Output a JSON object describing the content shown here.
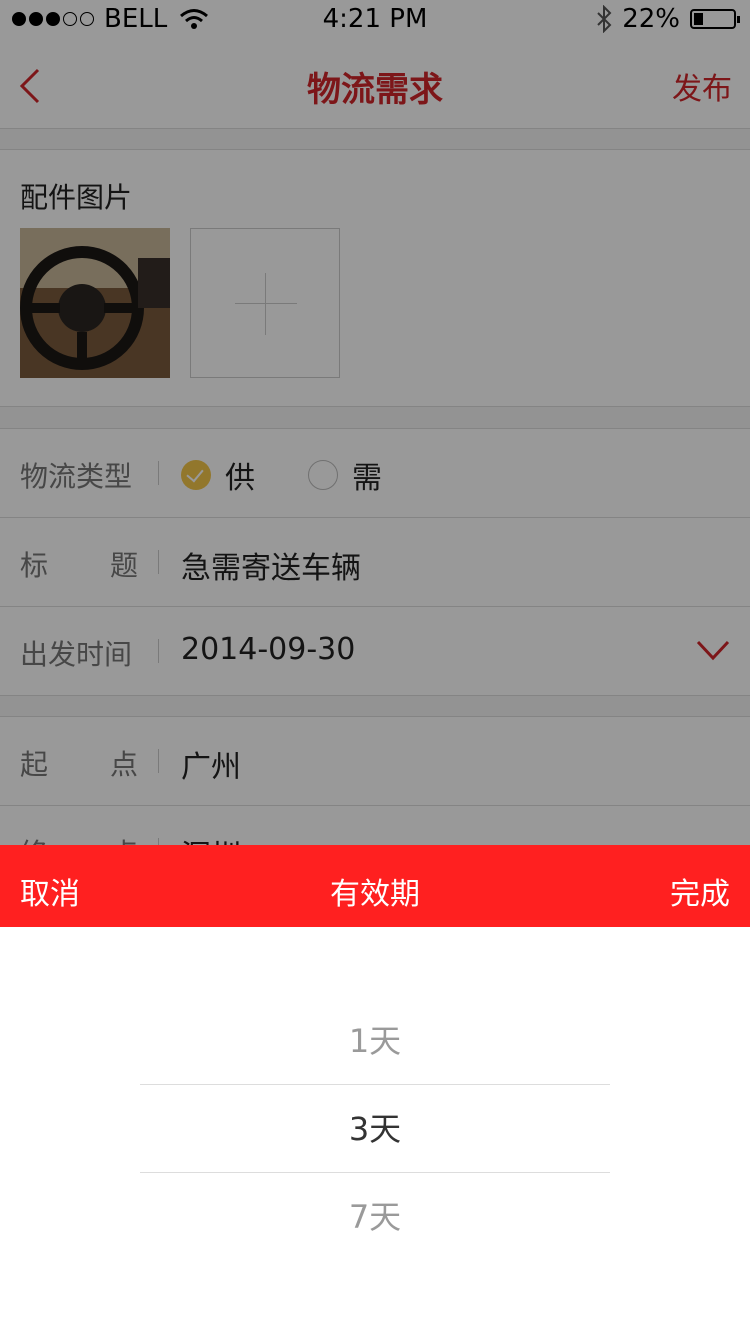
{
  "status_bar": {
    "carrier": "BELL",
    "time": "4:21 PM",
    "battery": "22%",
    "battery_level_percent": 22
  },
  "nav": {
    "title": "物流需求",
    "publish": "发布"
  },
  "photos": {
    "label": "配件图片"
  },
  "type_row": {
    "label": "物流类型",
    "options": [
      "供",
      "需"
    ],
    "selected": "供"
  },
  "title_row": {
    "label_a": "标",
    "label_b": "题",
    "value": "急需寄送车辆"
  },
  "depart_row": {
    "label": "出发时间",
    "value": "2014-09-30"
  },
  "start_row": {
    "label_a": "起",
    "label_b": "点",
    "value": "广州"
  },
  "end_row": {
    "label_a": "终",
    "label_b": "点",
    "value": "深圳"
  },
  "picker": {
    "cancel": "取消",
    "title": "有效期",
    "done": "完成",
    "options": [
      "1天",
      "3天",
      "7天"
    ],
    "selected": "3天"
  },
  "colors": {
    "accent": "#d0262a",
    "sheet_header": "#ff2020",
    "checked": "#f3c64a"
  }
}
